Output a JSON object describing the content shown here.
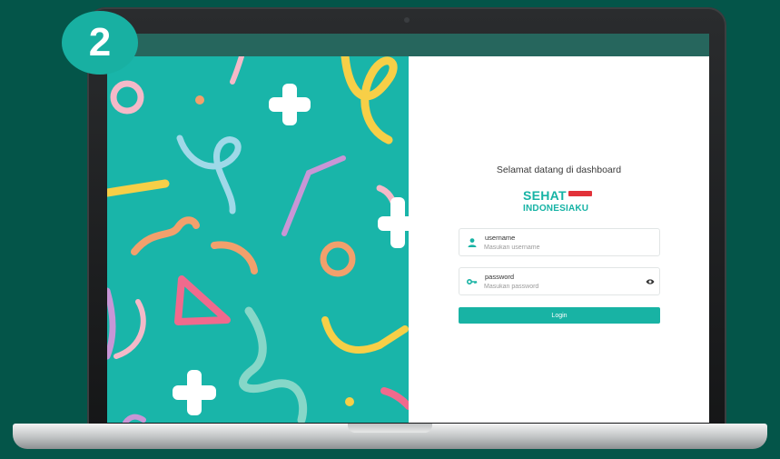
{
  "step_badge": {
    "number": "2"
  },
  "login": {
    "welcome_text": "Selamat datang di dashboard",
    "logo": {
      "line1": "SEHAT",
      "line2": "INDONESIAKU"
    },
    "username": {
      "label": "username",
      "placeholder": "Masukan username",
      "value": ""
    },
    "password": {
      "label": "password",
      "placeholder": "Masukan password",
      "value": ""
    },
    "login_button": "Login"
  },
  "colors": {
    "page_background": "#045549",
    "brand_teal": "#18b3a4",
    "left_panel": "#19b5a9",
    "flag_red": "#e2323a"
  },
  "icons": {
    "username": "user-icon",
    "password": "key-icon",
    "toggle_password": "eye-icon"
  }
}
